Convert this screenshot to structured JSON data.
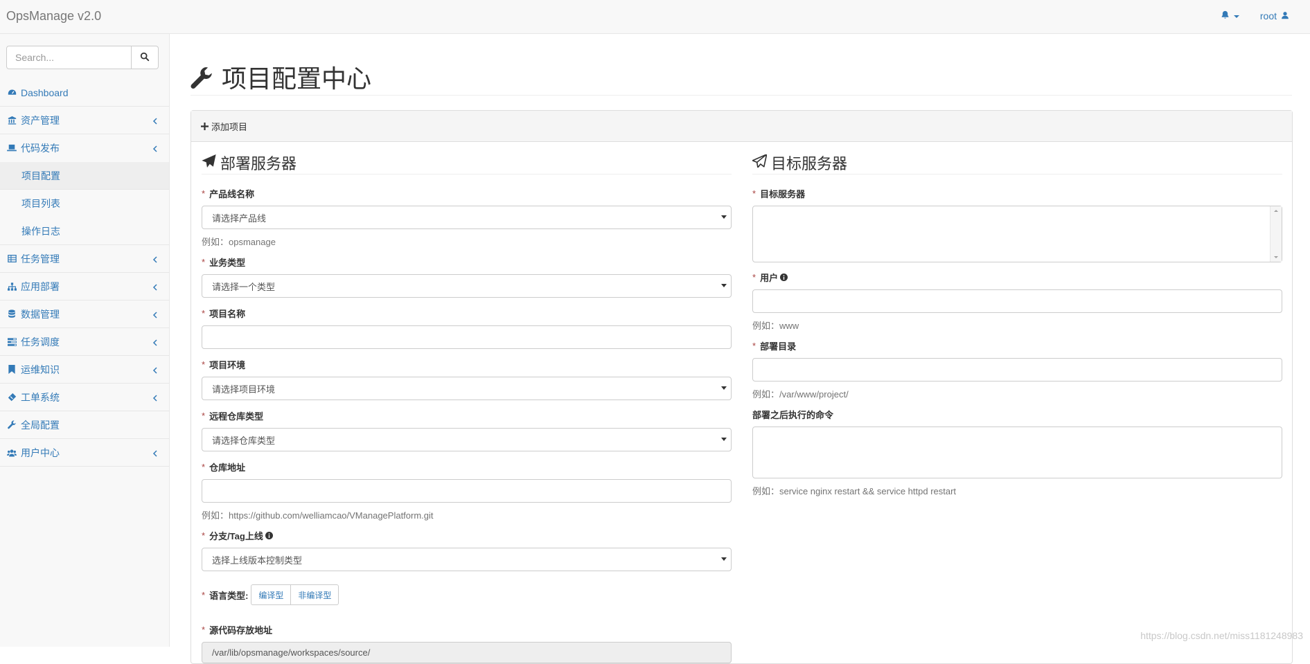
{
  "navbar": {
    "brand": "OpsManage v2.0",
    "user": "root"
  },
  "sidebar": {
    "search_placeholder": "Search...",
    "items": [
      {
        "label": "Dashboard",
        "icon": "dashboard-icon",
        "has_children": false
      },
      {
        "label": "资产管理",
        "icon": "bank-icon",
        "has_children": true
      },
      {
        "label": "代码发布",
        "icon": "laptop-icon",
        "has_children": true,
        "children": [
          {
            "label": "项目配置",
            "active": true
          },
          {
            "label": "项目列表",
            "active": false
          },
          {
            "label": "操作日志",
            "active": false
          }
        ]
      },
      {
        "label": "任务管理",
        "icon": "table-icon",
        "has_children": true
      },
      {
        "label": "应用部署",
        "icon": "sitemap-icon",
        "has_children": true
      },
      {
        "label": "数据管理",
        "icon": "database-icon",
        "has_children": true
      },
      {
        "label": "任务调度",
        "icon": "tasks-icon",
        "has_children": true
      },
      {
        "label": "运维知识",
        "icon": "bookmark-icon",
        "has_children": true
      },
      {
        "label": "工单系统",
        "icon": "ticket-icon",
        "has_children": true
      },
      {
        "label": "全局配置",
        "icon": "wrench-icon",
        "has_children": false
      },
      {
        "label": "用户中心",
        "icon": "users-icon",
        "has_children": true
      }
    ]
  },
  "page": {
    "title": "项目配置中心",
    "panel_heading": "添加项目"
  },
  "left": {
    "title": "部署服务器",
    "product_line": {
      "label": "产品线名称",
      "value": "请选择产品线",
      "help": "例如：opsmanage"
    },
    "business_type": {
      "label": "业务类型",
      "value": "请选择一个类型"
    },
    "project_name": {
      "label": "项目名称",
      "value": ""
    },
    "project_env": {
      "label": "项目环境",
      "value": "请选择项目环境"
    },
    "repo_type": {
      "label": "远程仓库类型",
      "value": "请选择仓库类型"
    },
    "repo_url": {
      "label": "仓库地址",
      "value": "",
      "help": "例如：https://github.com/welliamcao/VManagePlatform.git"
    },
    "branch": {
      "label": "分支/Tag上线",
      "value": "选择上线版本控制类型"
    },
    "lang": {
      "label": "语言类型:",
      "options": [
        "编译型",
        "非编译型"
      ]
    },
    "source_path": {
      "label": "源代码存放地址",
      "value": "/var/lib/opsmanage/workspaces/source/"
    }
  },
  "right": {
    "title": "目标服务器",
    "target_servers": {
      "label": "目标服务器",
      "value": ""
    },
    "user": {
      "label": "用户",
      "value": "",
      "help": "例如：www"
    },
    "deploy_dir": {
      "label": "部署目录",
      "value": "",
      "help": "例如：/var/www/project/"
    },
    "post_cmd": {
      "label": "部署之后执行的命令",
      "value": "",
      "help": "例如：service nginx restart && service httpd restart"
    }
  },
  "watermark": "https://blog.csdn.net/miss1181248983"
}
